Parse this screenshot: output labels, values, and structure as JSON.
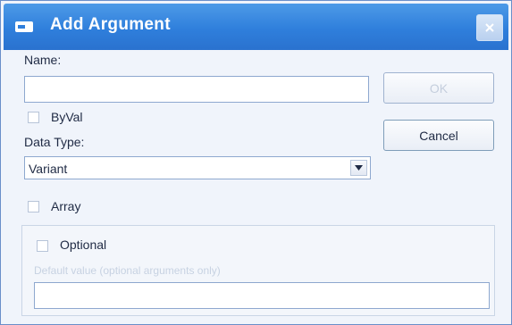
{
  "dialog": {
    "title": "Add Argument",
    "name_label": "Name:",
    "name_value": "",
    "byval_label": "ByVal",
    "data_type_label": "Data Type:",
    "data_type_value": "Variant",
    "array_label": "Array",
    "optional_label": "Optional",
    "default_value_label": "Default value (optional arguments only)",
    "default_value": "",
    "ok_label": "OK",
    "cancel_label": "Cancel",
    "colors": {
      "titlebar": "#2f7fdc",
      "window_bg": "#f0f4fb"
    }
  }
}
